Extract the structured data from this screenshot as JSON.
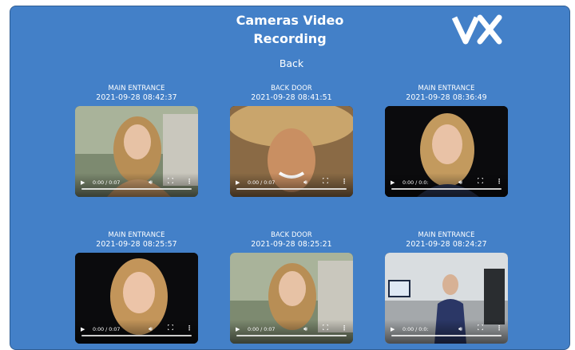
{
  "header": {
    "title_line1": "Cameras Video",
    "title_line2": "Recording",
    "logo_icon": "vx-logo-icon"
  },
  "nav": {
    "back_label": "Back"
  },
  "recordings": [
    {
      "camera": "MAIN ENTRANCE",
      "timestamp": "2021-09-28 08:42:37",
      "time": "0:00 / 0:07"
    },
    {
      "camera": "BACK DOOR",
      "timestamp": "2021-09-28 08:41:51",
      "time": "0:00 / 0:07"
    },
    {
      "camera": "MAIN ENTRANCE",
      "timestamp": "2021-09-28 08:36:49",
      "time": "0:00 / 0:0:"
    },
    {
      "camera": "MAIN ENTRANCE",
      "timestamp": "2021-09-28 08:25:57",
      "time": "0:00 / 0:07"
    },
    {
      "camera": "BACK DOOR",
      "timestamp": "2021-09-28 08:25:21",
      "time": "0:00 / 0:07"
    },
    {
      "camera": "MAIN ENTRANCE",
      "timestamp": "2021-09-28 08:24:27",
      "time": "0:00 / 0:0:"
    }
  ],
  "colors": {
    "background": "#4380c8",
    "text": "#ffffff"
  }
}
